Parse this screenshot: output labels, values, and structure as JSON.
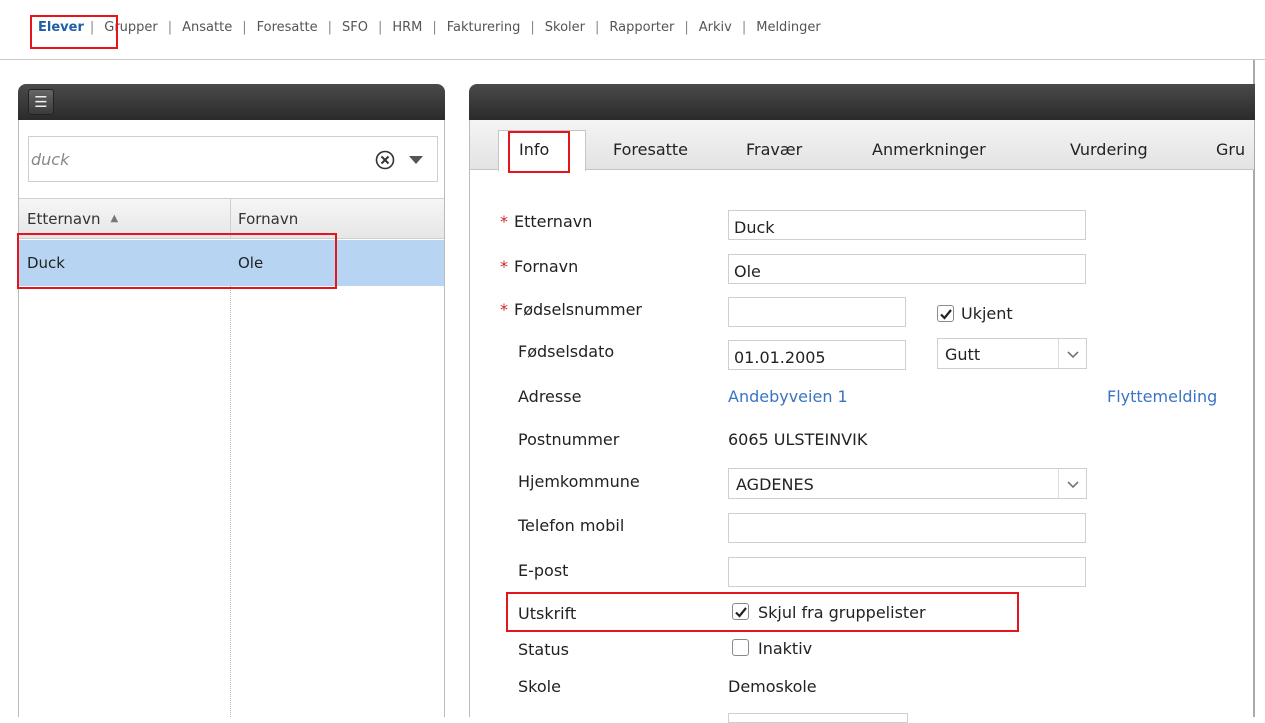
{
  "nav": {
    "items": [
      "Elever",
      "Grupper",
      "Ansatte",
      "Foresatte",
      "SFO",
      "HRM",
      "Fakturering",
      "Skoler",
      "Rapporter",
      "Arkiv",
      "Meldinger"
    ],
    "active": "Elever"
  },
  "left": {
    "search": {
      "value": "duck",
      "placeholder": ""
    },
    "columns": {
      "col1": "Etternavn",
      "col2": "Fornavn"
    },
    "rows": [
      {
        "etternavn": "Duck",
        "fornavn": "Ole"
      }
    ]
  },
  "tabs": [
    "Info",
    "Foresatte",
    "Fravær",
    "Anmerkninger",
    "Vurdering",
    "Gru"
  ],
  "form": {
    "etternavn": {
      "label": "Etternavn",
      "value": "Duck",
      "required": true
    },
    "fornavn": {
      "label": "Fornavn",
      "value": "Ole",
      "required": true
    },
    "fodselsnummer": {
      "label": "Fødselsnummer",
      "value": "",
      "required": true
    },
    "ukjent": {
      "label": "Ukjent",
      "checked": true
    },
    "fodselsdato": {
      "label": "Fødselsdato",
      "value": "01.01.2005"
    },
    "kjonn": {
      "value": "Gutt"
    },
    "adresse": {
      "label": "Adresse",
      "value": "Andebyveien 1"
    },
    "flyttemelding": "Flyttemelding",
    "postnummer": {
      "label": "Postnummer",
      "value": "6065 ULSTEINVIK"
    },
    "hjemkommune": {
      "label": "Hjemkommune",
      "value": "AGDENES"
    },
    "telefon": {
      "label": "Telefon mobil",
      "value": ""
    },
    "epost": {
      "label": "E-post",
      "value": ""
    },
    "utskrift": {
      "label": "Utskrift",
      "option": "Skjul fra gruppelister",
      "checked": true
    },
    "status": {
      "label": "Status",
      "option": "Inaktiv",
      "checked": false
    },
    "skole": {
      "label": "Skole",
      "value": "Demoskole"
    }
  },
  "colors": {
    "accent": "#1f5fa8",
    "highlight": "#e4161d",
    "link": "#3a74c4",
    "row_selected": "#b7d5f3"
  }
}
